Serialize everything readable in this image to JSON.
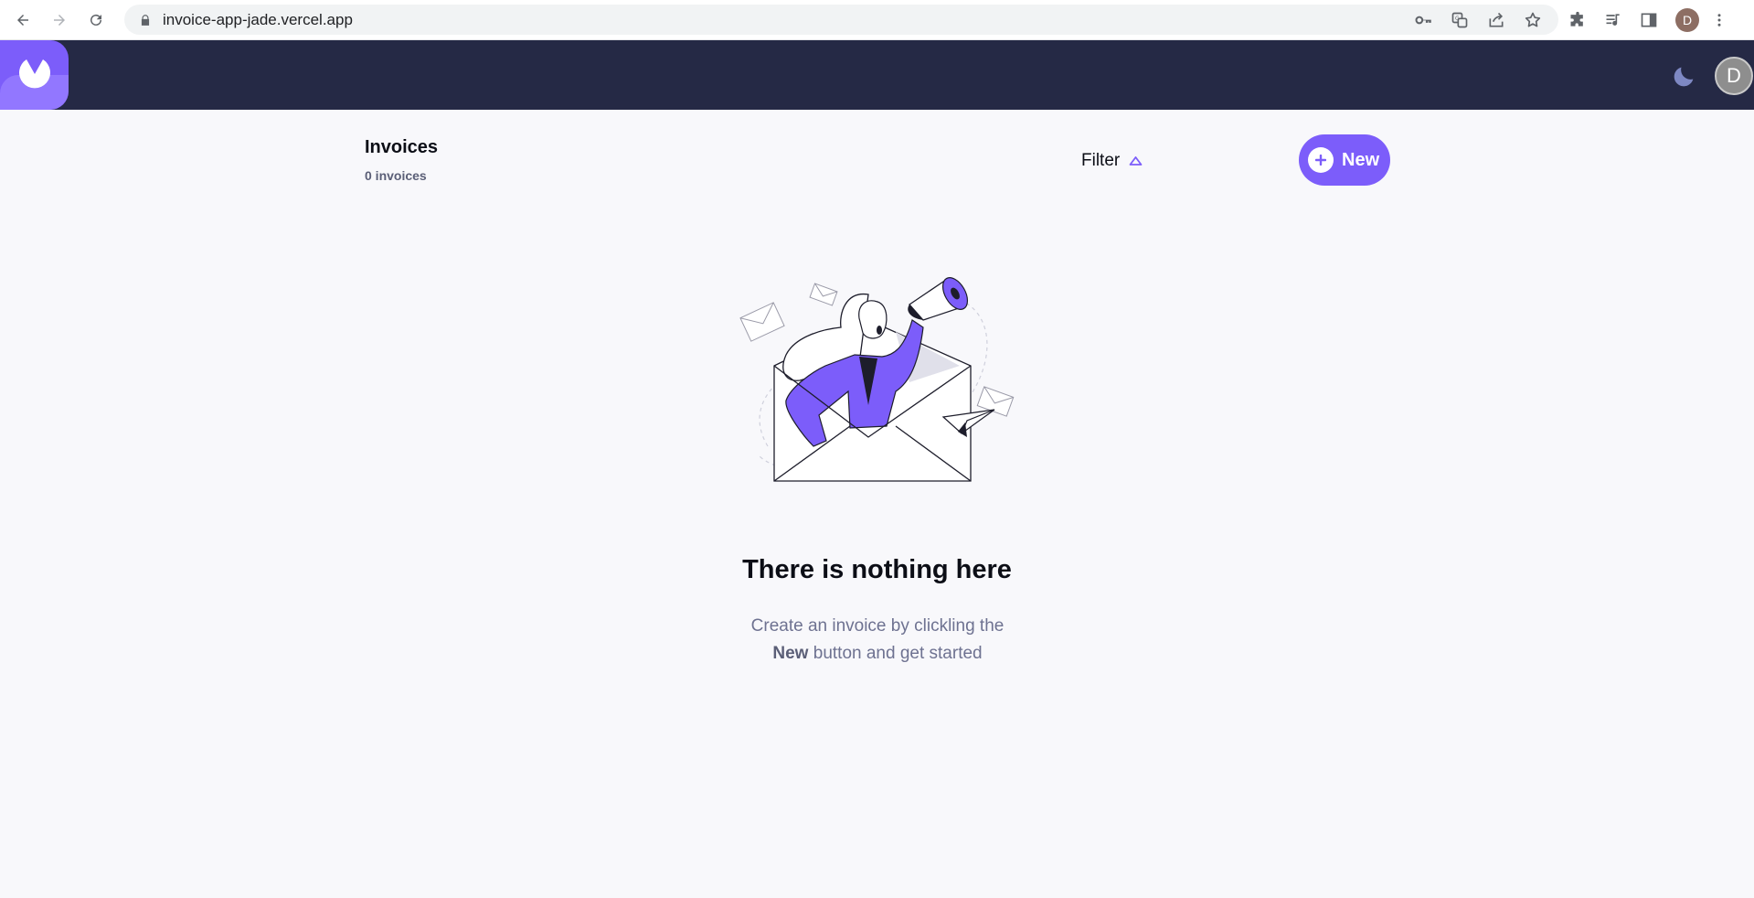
{
  "browser": {
    "url": "invoice-app-jade.vercel.app",
    "profile_initial": "D"
  },
  "header": {
    "avatar_initial": "D",
    "accent": "#7c5dfa",
    "bar_color": "#252945"
  },
  "main": {
    "title": "Invoices",
    "count_label": "0 invoices",
    "filter_label": "Filter",
    "new_button_label": "New"
  },
  "empty_state": {
    "heading": "There is nothing here",
    "line1": "Create an invoice by clickling the",
    "line2_bold": "New",
    "line2_rest": " button and get started"
  }
}
